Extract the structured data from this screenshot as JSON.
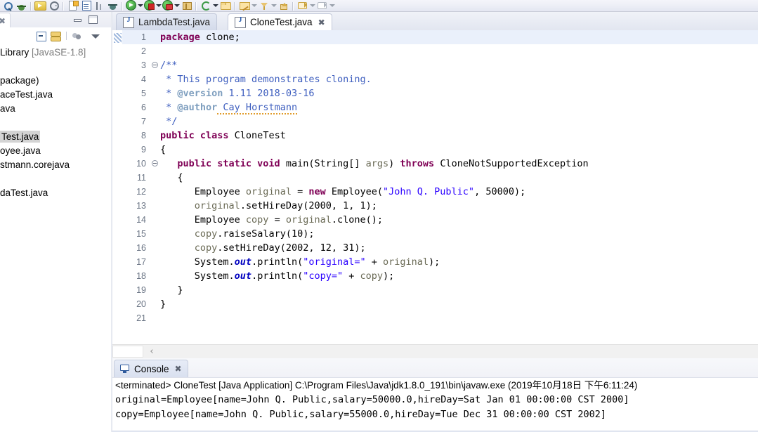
{
  "toolbar": {
    "icons": [
      {
        "name": "search-icon",
        "cls": "g-search"
      },
      {
        "name": "debug-icon",
        "cls": "g-bug"
      },
      {
        "name": "run-external-tools-icon",
        "cls": "g-run"
      },
      {
        "name": "settings-icon",
        "cls": "g-gear"
      },
      {
        "name": "new-java-class-icon",
        "cls": "g-newfile"
      },
      {
        "name": "open-task-icon",
        "cls": "g-list"
      },
      {
        "name": "skip-breakpoints-icon",
        "cls": "g-bars"
      },
      {
        "name": "ant-build-icon",
        "cls": "g-antlike"
      },
      {
        "name": "run-icon",
        "cls": "g-green"
      },
      {
        "name": "debug-as-icon",
        "cls": "g-greenred"
      },
      {
        "name": "run-as-icon",
        "cls": "g-greentool"
      },
      {
        "name": "external-tools-icon",
        "cls": "g-box"
      },
      {
        "name": "refresh-icon",
        "cls": "g-refresh"
      },
      {
        "name": "open-folder-icon",
        "cls": "g-folder"
      },
      {
        "name": "open-type-icon",
        "cls": "g-pencil"
      },
      {
        "name": "filter-icon",
        "cls": "g-funnel"
      },
      {
        "name": "upload-icon",
        "cls": "g-upload"
      },
      {
        "name": "annotation-prev-icon",
        "cls": "g-tag"
      },
      {
        "name": "annotation-next-icon",
        "cls": "g-tagw"
      }
    ]
  },
  "explorer": {
    "tab_label": "",
    "tab_close": "✖",
    "toolbar_icons": [
      "collapse-all-icon",
      "link-with-editor-icon",
      "view-filter-icon",
      "view-menu-icon"
    ],
    "tree": [
      {
        "text": "Library ",
        "dim": "[JavaSE-1.8]",
        "selected": false
      },
      {
        "text": "",
        "dim": "",
        "selected": false,
        "gap": true
      },
      {
        "text": "package)",
        "dim": "",
        "selected": false
      },
      {
        "text": "aceTest.java",
        "dim": "",
        "selected": false
      },
      {
        "text": "ava",
        "dim": "",
        "selected": false
      },
      {
        "text": "",
        "dim": "",
        "selected": false,
        "gap": true
      },
      {
        "text": "Test.java",
        "dim": "",
        "selected": true
      },
      {
        "text": "oyee.java",
        "dim": "",
        "selected": false
      },
      {
        "text": "stmann.corejava",
        "dim": "",
        "selected": false
      },
      {
        "text": "",
        "dim": "",
        "selected": false,
        "gap": true
      },
      {
        "text": "daTest.java",
        "dim": "",
        "selected": false
      }
    ]
  },
  "editor": {
    "tabs": [
      {
        "label": "LambdaTest.java",
        "active": false,
        "closable": false
      },
      {
        "label": "CloneTest.java",
        "active": true,
        "closable": true,
        "close_glyph": "✖"
      }
    ],
    "line_numbers": [
      "1",
      "2",
      "3",
      "4",
      "5",
      "6",
      "7",
      "8",
      "9",
      "10",
      "11",
      "12",
      "13",
      "14",
      "15",
      "16",
      "17",
      "18",
      "19",
      "20",
      "21"
    ],
    "folding_lines": [
      3,
      10
    ],
    "highlighted_line": 1,
    "hscroll_left_arrow": "‹",
    "lines": [
      [
        {
          "t": "package",
          "c": "k"
        },
        {
          "t": " clone;",
          "c": "n"
        }
      ],
      [],
      [
        {
          "t": "/**",
          "c": "cj"
        }
      ],
      [
        {
          "t": " * This program demonstrates cloning.",
          "c": "cj"
        }
      ],
      [
        {
          "t": " * ",
          "c": "cj"
        },
        {
          "t": "@version",
          "c": "ct"
        },
        {
          "t": " 1.11 2018-03-16",
          "c": "cj"
        }
      ],
      [
        {
          "t": " * ",
          "c": "cj"
        },
        {
          "t": "@author",
          "c": "ct"
        },
        {
          "t": " Cay Horstmann",
          "c": "cj spell"
        }
      ],
      [
        {
          "t": " */",
          "c": "cj"
        }
      ],
      [
        {
          "t": "public class",
          "c": "k"
        },
        {
          "t": " CloneTest",
          "c": "n"
        }
      ],
      [
        {
          "t": "{",
          "c": "n"
        }
      ],
      [
        {
          "t": "   ",
          "c": "n"
        },
        {
          "t": "public static void",
          "c": "k"
        },
        {
          "t": " main(String[] ",
          "c": "n"
        },
        {
          "t": "args",
          "c": "pm"
        },
        {
          "t": ") ",
          "c": "n"
        },
        {
          "t": "throws",
          "c": "k"
        },
        {
          "t": " CloneNotSupportedException",
          "c": "n"
        }
      ],
      [
        {
          "t": "   {",
          "c": "n"
        }
      ],
      [
        {
          "t": "      Employee ",
          "c": "n"
        },
        {
          "t": "original",
          "c": "lv"
        },
        {
          "t": " = ",
          "c": "n"
        },
        {
          "t": "new",
          "c": "k"
        },
        {
          "t": " Employee(",
          "c": "n"
        },
        {
          "t": "\"John Q. Public\"",
          "c": "s"
        },
        {
          "t": ", 50000);",
          "c": "n"
        }
      ],
      [
        {
          "t": "      ",
          "c": "n"
        },
        {
          "t": "original",
          "c": "lv"
        },
        {
          "t": ".setHireDay(2000, 1, 1);",
          "c": "n"
        }
      ],
      [
        {
          "t": "      Employee ",
          "c": "n"
        },
        {
          "t": "copy",
          "c": "lv"
        },
        {
          "t": " = ",
          "c": "n"
        },
        {
          "t": "original",
          "c": "lv"
        },
        {
          "t": ".clone();",
          "c": "n"
        }
      ],
      [
        {
          "t": "      ",
          "c": "n"
        },
        {
          "t": "copy",
          "c": "lv"
        },
        {
          "t": ".raiseSalary(10);",
          "c": "n"
        }
      ],
      [
        {
          "t": "      ",
          "c": "n"
        },
        {
          "t": "copy",
          "c": "lv"
        },
        {
          "t": ".setHireDay(2002, 12, 31);",
          "c": "n"
        }
      ],
      [
        {
          "t": "      System.",
          "c": "n"
        },
        {
          "t": "out",
          "c": "sf"
        },
        {
          "t": ".println(",
          "c": "n"
        },
        {
          "t": "\"original=\"",
          "c": "s"
        },
        {
          "t": " + ",
          "c": "n"
        },
        {
          "t": "original",
          "c": "lv"
        },
        {
          "t": ");",
          "c": "n"
        }
      ],
      [
        {
          "t": "      System.",
          "c": "n"
        },
        {
          "t": "out",
          "c": "sf"
        },
        {
          "t": ".println(",
          "c": "n"
        },
        {
          "t": "\"copy=\"",
          "c": "s"
        },
        {
          "t": " + ",
          "c": "n"
        },
        {
          "t": "copy",
          "c": "lv"
        },
        {
          "t": ");",
          "c": "n"
        }
      ],
      [
        {
          "t": "   }",
          "c": "n"
        }
      ],
      [
        {
          "t": "}",
          "c": "n"
        }
      ],
      []
    ]
  },
  "console": {
    "tab_label": "Console",
    "tab_close": "✖",
    "header": "<terminated> CloneTest [Java Application] C:\\Program Files\\Java\\jdk1.8.0_191\\bin\\javaw.exe (2019年10月18日 下午6:11:24)",
    "output": [
      "original=Employee[name=John Q. Public,salary=50000.0,hireDay=Sat Jan 01 00:00:00 CST 2000]",
      "copy=Employee[name=John Q. Public,salary=55000.0,hireDay=Tue Dec 31 00:00:00 CST 2002]"
    ]
  }
}
